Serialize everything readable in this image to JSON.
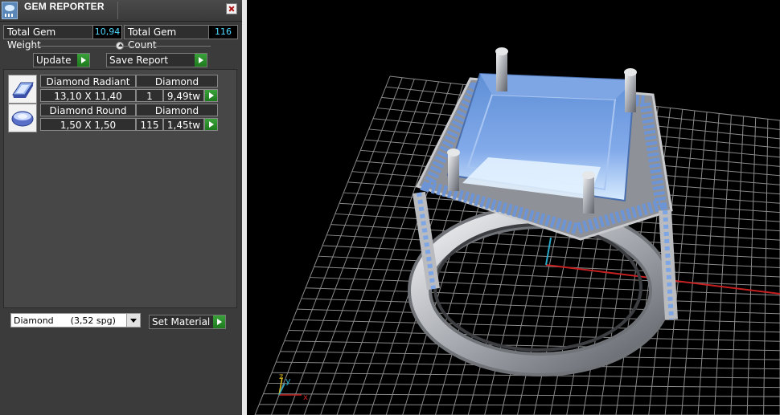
{
  "window": {
    "title": "GEM REPORTER",
    "app_icon": "gem-reporter-icon",
    "close_icon": "close-icon"
  },
  "totals": {
    "weight_label": "Total Gem Weight",
    "weight_value": "10,94",
    "count_label": "Total Gem Count",
    "count_value": "116"
  },
  "actions": {
    "update_label": "Update",
    "save_report_label": "Save Report"
  },
  "gems": [
    {
      "name": "Diamond Radiant",
      "material": "Diamond",
      "size": "13,10 X 11,40",
      "count": "1",
      "weight": "9,49tw",
      "icon": "radiant-cut-gem-icon"
    },
    {
      "name": "Diamond Round",
      "material": "Diamond",
      "size": "1,50 X 1,50",
      "count": "115",
      "weight": "1,45tw",
      "icon": "round-cut-gem-icon"
    }
  ],
  "material": {
    "selected": "Diamond      (3,52 spg)",
    "set_label": "Set Material"
  },
  "viewport": {
    "axis_labels": {
      "x": "x",
      "y": "y",
      "z": "z"
    },
    "colors": {
      "background": "#000000",
      "grid": "#8a8a8a",
      "axis_x": "#c62020",
      "axis_y": "#2aa9c9",
      "gem": "#6b9be0",
      "metal": "#c9cbcf"
    }
  },
  "colors": {
    "panel": "#3b3b3b",
    "value_text": "#4ed7ff",
    "go_button": "#2a8f2a"
  }
}
